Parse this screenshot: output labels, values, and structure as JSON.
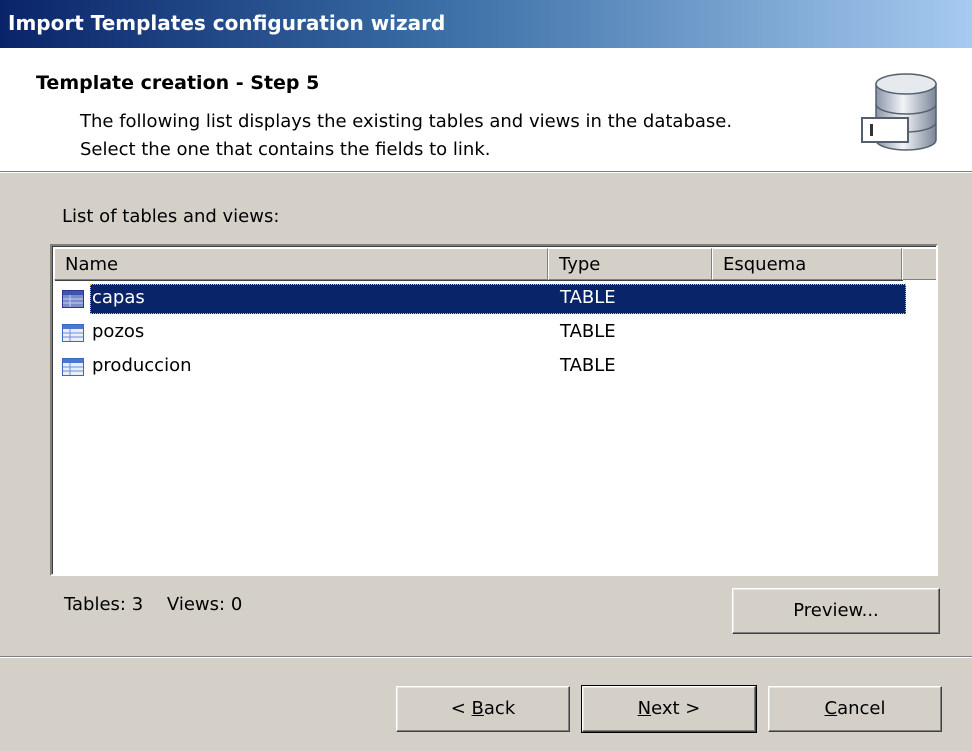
{
  "window": {
    "title": "Import Templates configuration wizard"
  },
  "header": {
    "step_title": "Template creation - Step 5",
    "description_line1": "The following list displays the existing tables and views in the database.",
    "description_line2": "Select the one that contains the fields to link.",
    "icon": "database-icon"
  },
  "list": {
    "label": "List of tables and views:",
    "columns": [
      "Name",
      "Type",
      "Esquema"
    ],
    "rows": [
      {
        "name": "capas",
        "type": "TABLE",
        "esquema": "",
        "selected": true,
        "icon": "table-icon"
      },
      {
        "name": "pozos",
        "type": "TABLE",
        "esquema": "",
        "selected": false,
        "icon": "table-icon"
      },
      {
        "name": "produccion",
        "type": "TABLE",
        "esquema": "",
        "selected": false,
        "icon": "table-icon"
      }
    ]
  },
  "counts": {
    "tables_label": "Tables:",
    "tables_value": "3",
    "views_label": "Views:",
    "views_value": "0"
  },
  "buttons": {
    "preview": "Preview...",
    "back_prefix": "< ",
    "back_mnemonic": "B",
    "back_rest": "ack",
    "next_mnemonic": "N",
    "next_rest": "ext >",
    "cancel_mnemonic": "C",
    "cancel_rest": "ancel"
  },
  "colors": {
    "titlebar_start": "#0a246a",
    "titlebar_end": "#a6caf0",
    "selection": "#0a246a",
    "dialog_bg": "#d4d0c8"
  }
}
